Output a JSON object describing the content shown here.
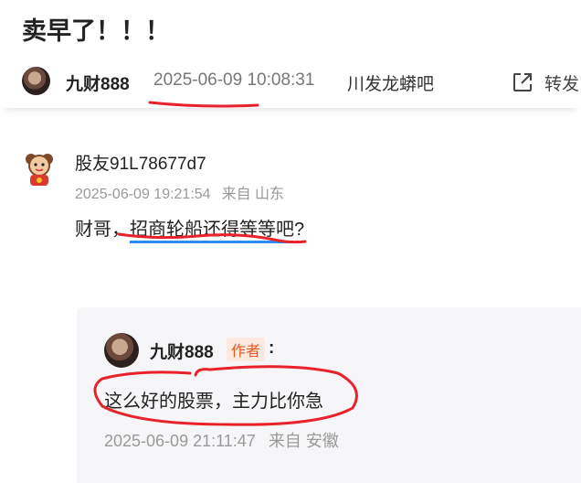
{
  "post": {
    "title": "卖早了！！！",
    "author": "九财888",
    "time": "2025-06-09 10:08:31",
    "forum": "川发龙蟒吧",
    "share_label": "转发"
  },
  "comment": {
    "user": "股友91L78677d7",
    "time": "2025-06-09 19:21:54",
    "location": "来自 山东",
    "text_prefix": "财哥，",
    "text_highlight": "招商轮船还得等等吧",
    "text_suffix": "?"
  },
  "reply": {
    "author": "九财888",
    "badge": "作者",
    "colon": ":",
    "text": "这么好的股票，主力比你急",
    "time": "2025-06-09 21:11:47",
    "location": "来自 安徽"
  },
  "icons": {
    "share": "share-external-icon"
  },
  "colors": {
    "highlight_underline": "#2f8cf0",
    "red_markup": "#e8222b",
    "author_badge": "#e8561f"
  }
}
